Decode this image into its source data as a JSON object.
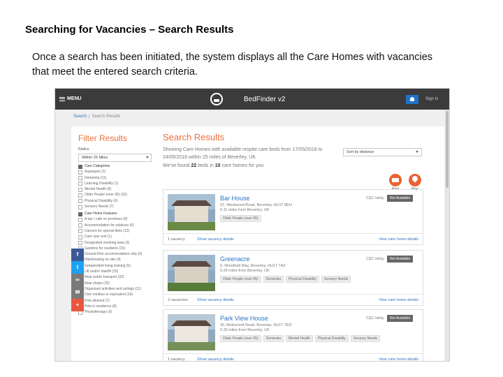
{
  "slide": {
    "title": "Searching for Vacancies – Search Results",
    "description": "Once a search has been initiated, the system displays all the Care Homes with vacancies that meet the entered search criteria."
  },
  "app": {
    "menu_label": "MENU",
    "brand": "BedFinder v2",
    "signin": "Sign in",
    "breadcrumb": [
      "Search",
      "Search Results"
    ]
  },
  "filter": {
    "title": "Filter Results",
    "radius_label": "Radius",
    "radius_value": "Within 25 Miles",
    "care_header": "Care Categories",
    "care_categories": [
      "Aspergers (1)",
      "Dementia (11)",
      "Learning Disability (1)",
      "Mental Health (6)",
      "Older People (over 65) (22)",
      "Physical Disability (0)",
      "Sensory Needs (7)"
    ],
    "features_header": "Care Home Features",
    "features": [
      "A bar / cafe on premises (8)",
      "Accommodation for relatives (5)",
      "Careers for special diets (12)",
      "Care user unit (1)",
      "Designated smoking area (3)",
      "Gardens for residents (16)",
      "Ground floor accommodation only (5)",
      "Hairdressing on site (4)",
      "Independent living training (5)",
      "Lift and/or stairlift (15)",
      "Near public transport (22)",
      "Near shops (15)",
      "Organised activities and outings (11)",
      "Own minibus or equivalent (16)",
      "Pets allowed (7)",
      "Pets in residence (8)",
      "Physiotherapy (9)"
    ]
  },
  "results": {
    "title": "Search Results",
    "summary": "Showing Care Homes with available respite care beds from 17/05/2018 to 24/05/2018 within 25 miles of Beverley, UK",
    "found_prefix": "We've found ",
    "beds": "22",
    "found_mid": " beds in ",
    "homes": "10",
    "found_suffix": " care homes for you",
    "sort_value": "Sort by distance",
    "print_label": "Print",
    "map_label": "Map",
    "cqc_label": "CQC rating",
    "homes_list": [
      {
        "name": "Bar House",
        "address": "37, Westwood Road, Beverley, HU17 8EH",
        "distance": "0.11 miles from Beverley, UK",
        "tags": [
          "Older People (over 65)"
        ],
        "rating": "Not Available",
        "vacancies": "1 vacancy",
        "vacancy_link": "Show vacancy details",
        "page_link": "View care home details"
      },
      {
        "name": "Greenacre",
        "address": "5, Woodhall Way, Beverley, HU17 7AZ",
        "distance": "0.29 miles from Beverley, UK",
        "tags": [
          "Older People (over 65)",
          "Dementia",
          "Physical Disability",
          "Sensory Needs"
        ],
        "rating": "Not Available",
        "vacancies": "2 vacancies",
        "vacancy_link": "Show vacancy details",
        "page_link": "View care home details"
      },
      {
        "name": "Park View House",
        "address": "30, Molescroft Road, Beverley, HU17 7ED",
        "distance": "0.33 miles from Beverley, UK",
        "tags": [
          "Older People (over 65)",
          "Dementia",
          "Mental Health",
          "Physical Disability",
          "Sensory Needs"
        ],
        "rating": "Not Available",
        "vacancies": "1 vacancy",
        "vacancy_link": "Show vacancy details",
        "page_link": "View care home details"
      }
    ]
  },
  "social": [
    {
      "icon": "facebook-icon",
      "glyph": "f",
      "color": "#3b5998"
    },
    {
      "icon": "twitter-icon",
      "glyph": "t",
      "color": "#1da1f2"
    },
    {
      "icon": "link-icon",
      "glyph": "∞",
      "color": "#7a7a7a"
    },
    {
      "icon": "email-icon",
      "glyph": "✉",
      "color": "#7a7a7a"
    },
    {
      "icon": "plus-icon",
      "glyph": "+",
      "color": "#e8563f"
    }
  ]
}
